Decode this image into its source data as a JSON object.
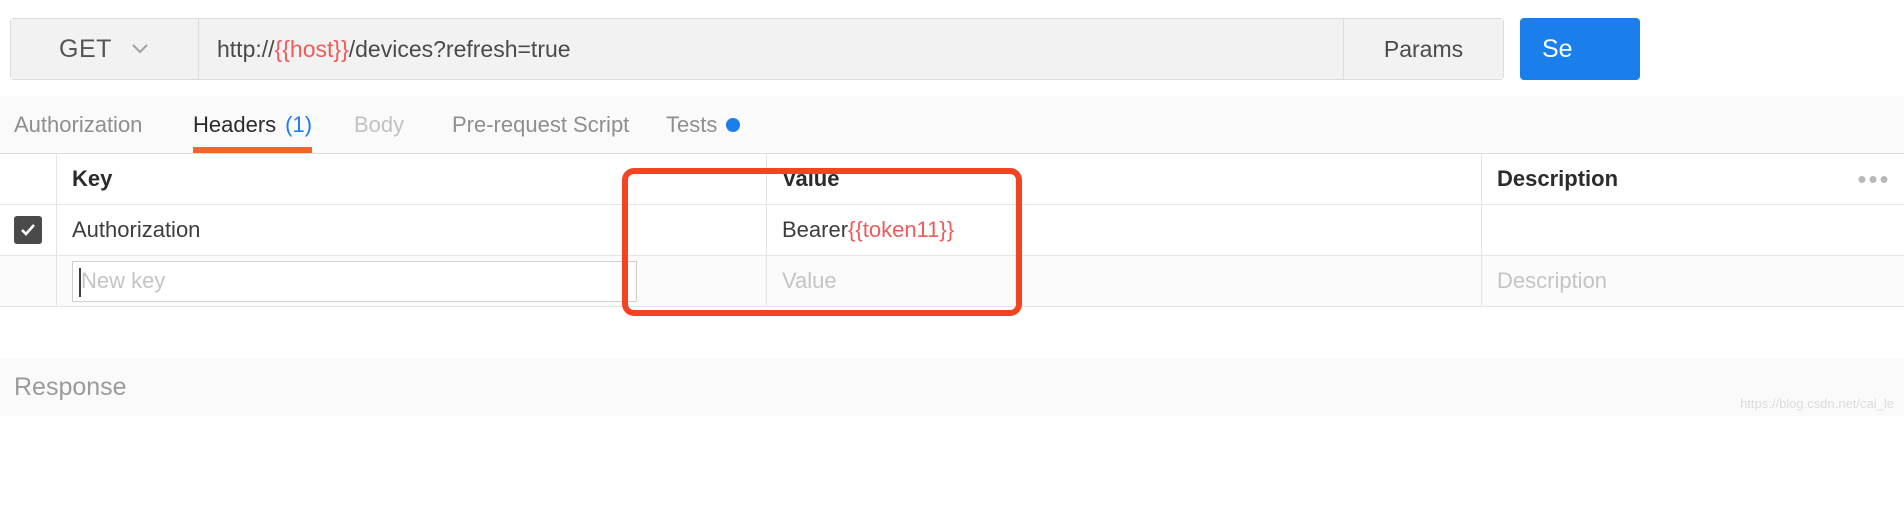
{
  "request_bar": {
    "method": "GET",
    "method_caret_icon": "chevron-down-icon",
    "url_prefix": "http://",
    "url_template_var": "{{host}}",
    "url_suffix": "/devices?refresh=true",
    "params_label": "Params",
    "send_label": "Se",
    "send_color": "#1a7fea",
    "template_color": "#f05a5a"
  },
  "tabs": [
    {
      "label": "Authorization",
      "state": "inactive"
    },
    {
      "label": "Headers",
      "count": "(1)",
      "state": "active"
    },
    {
      "label": "Body",
      "state": "disabled"
    },
    {
      "label": "Pre-request Script",
      "state": "inactive"
    },
    {
      "label": "Tests",
      "state": "inactive",
      "dot": true
    }
  ],
  "tab_accent_color": "#f26522",
  "tab_count_color": "#1a7fea",
  "headers_table": {
    "columns": [
      "Key",
      "Value",
      "Description"
    ],
    "overflow_icon": "ellipsis-icon",
    "overflow_glyph": "•••",
    "rows": [
      {
        "checked": true,
        "checkmark_icon": "check-icon",
        "key": "Authorization",
        "value_prefix": "Bearer ",
        "value_template_var": "{{token11}}",
        "description": ""
      }
    ],
    "new_row": {
      "key_placeholder": "New key",
      "value_placeholder": "Value",
      "description_placeholder": "Description"
    }
  },
  "response": {
    "label": "Response"
  },
  "annotation": {
    "type": "highlight-rectangle",
    "color": "#f44322"
  },
  "watermark": {
    "text": "https://blog.csdn.net/cai_le"
  }
}
